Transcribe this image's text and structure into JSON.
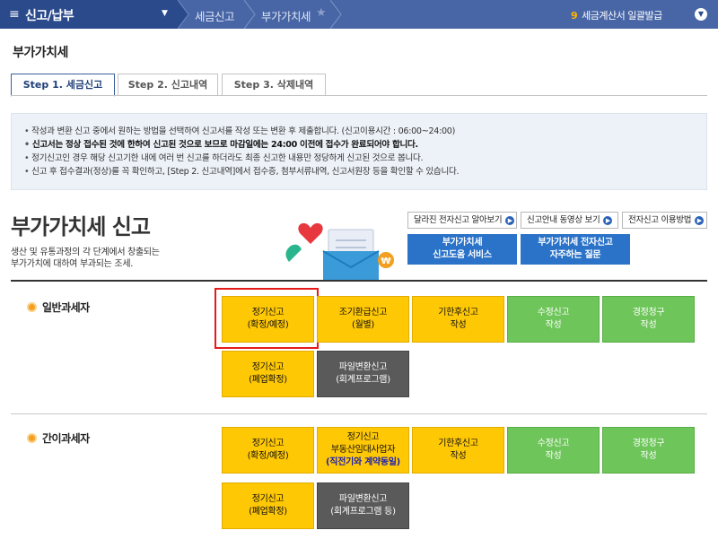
{
  "topbar": {
    "menu_icon": "≡",
    "menu_title": "신고/납부",
    "menu_caret": "▼",
    "crumbs": [
      "세금신고",
      "부가가치세"
    ],
    "right_num": "9",
    "right_text": "세금계산서 일괄발급",
    "right_icon": "chevron-down-icon"
  },
  "page_title": "부가가치세",
  "tabs": [
    {
      "label": "Step 1. 세금신고",
      "active": true
    },
    {
      "label": "Step 2. 신고내역",
      "active": false
    },
    {
      "label": "Step 3. 삭제내역",
      "active": false
    }
  ],
  "notice": [
    "작성과 변환 신고 중에서 원하는 방법을 선택하여 신고서를 작성 또는 변환 후 제출합니다. (신고이용시간 : 06:00~24:00)",
    "신고서는 정상 접수된 것에 한하여 신고된 것으로 보므로 마감일에는 24:00 이전에 접수가 완료되어야 합니다.",
    "정기신고인 경우 해당 신고기한 내에 여러 번 신고를 하더라도 최종 신고한 내용만 정당하게 신고된 것으로 봅니다.",
    "신고 후 접수결과(정상)를 꼭 확인하고, [Step 2. 신고내역]에서 접수증, 첨부서류내역, 신고서원장 등을 확인할 수 있습니다."
  ],
  "heading": "부가가치세 신고",
  "desc_lines": [
    "생산 및 유통과정의 각 단계에서 창출되는",
    "부가가치에 대하여 부과되는 조세."
  ],
  "link_buttons": [
    "달라진 전자신고 알아보기",
    "신고안내 동영상 보기",
    "전자신고 이용방법"
  ],
  "blue_buttons": [
    [
      "부가가치세",
      "신고도움 서비스"
    ],
    [
      "부가가치세 전자신고",
      "자주하는 질문"
    ]
  ],
  "general": {
    "label": "일반과세자",
    "tiles": [
      [
        "정기신고",
        "(확정/예정)"
      ],
      [
        "조기환급신고",
        "(월별)"
      ],
      [
        "기한후신고",
        "작성"
      ],
      [
        "수정신고",
        "작성"
      ],
      [
        "경정청구",
        "작성"
      ],
      [
        "정기신고",
        "(폐업확정)"
      ],
      [
        "파일변환신고",
        "(회계프로그램)"
      ]
    ]
  },
  "simple": {
    "label": "간이과세자",
    "tiles": [
      [
        "정기신고",
        "(확정/예정)"
      ],
      [
        "정기신고",
        "부동산임대사업자",
        "(직전기와 계약동일)"
      ],
      [
        "기한후신고",
        "작성"
      ],
      [
        "수정신고",
        "작성"
      ],
      [
        "경정청구",
        "작성"
      ],
      [
        "정기신고",
        "(폐업확정)"
      ],
      [
        "파일변환신고",
        "(회계프로그램 등)"
      ]
    ]
  },
  "colors": {
    "topbar": "#4866a6",
    "menu": "#2a4a8c",
    "yellow": "#ffc805",
    "green": "#6ec55a",
    "dark": "#5a5a5a",
    "blue": "#2b73c8",
    "highlight": "#e51b1b"
  }
}
